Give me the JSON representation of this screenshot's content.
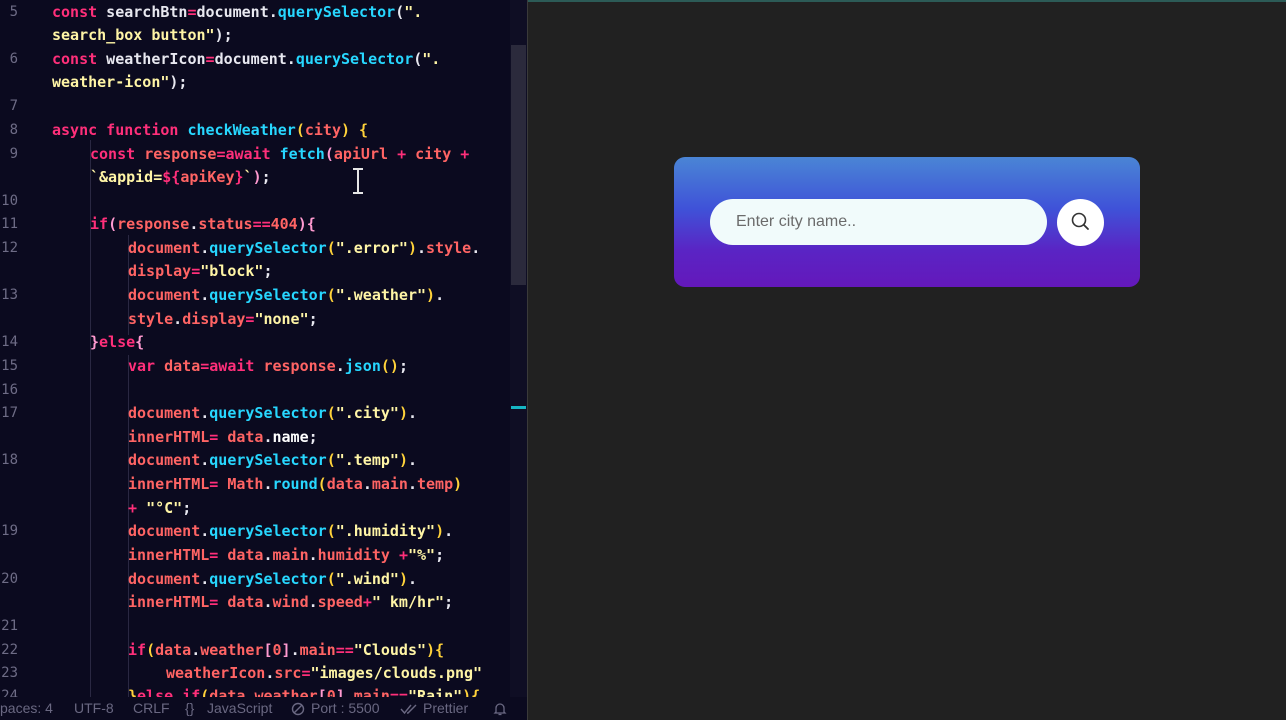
{
  "editor": {
    "line_numbers": [
      "5",
      "6",
      "7",
      "8",
      "9",
      "10",
      "11",
      "12",
      "13",
      "14",
      "15",
      "16",
      "17",
      "18",
      "19",
      "20",
      "21",
      "22",
      "23",
      "24"
    ]
  },
  "preview": {
    "search_placeholder": "Enter city name.."
  },
  "statusbar": {
    "spaces": "paces: 4",
    "encoding": "UTF-8",
    "line_ending": "CRLF",
    "language": "JavaScript",
    "port": "Port : 5500",
    "formatter": "Prettier"
  },
  "icons": {
    "search": "search-icon",
    "language": "braces-icon",
    "port": "circle-slash-icon",
    "formatter": "double-check-icon",
    "notifications": "bell-icon"
  },
  "colors": {
    "editor_bg": "#0b0a1f",
    "preview_bg": "#212121",
    "card_top": "#4a85d5",
    "card_bottom": "#6418bb",
    "keyword": "#ff2f7a",
    "function": "#27d7ff",
    "string": "#fff5a6"
  }
}
